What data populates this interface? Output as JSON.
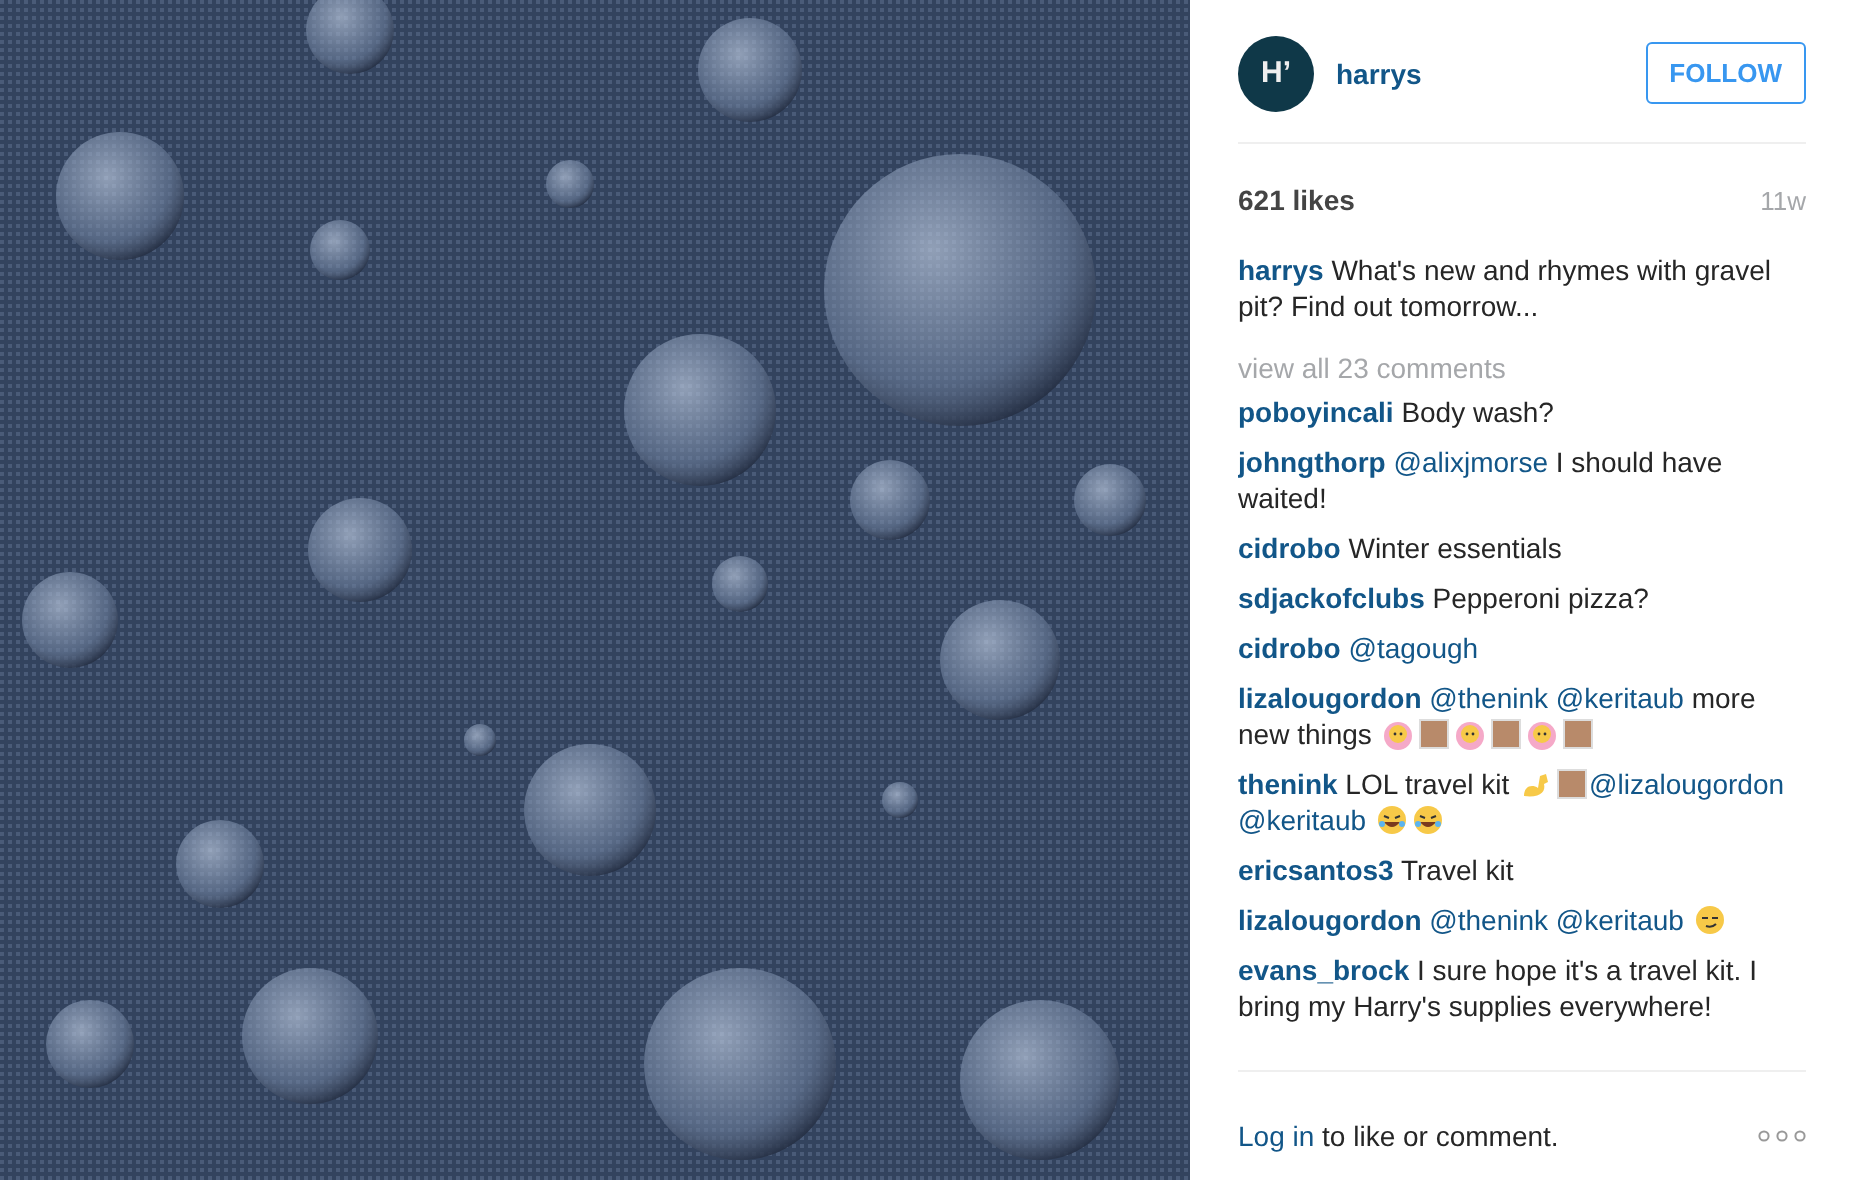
{
  "post": {
    "avatar_letter": "H’",
    "username": "harrys",
    "follow_button": "FOLLOW",
    "likes": "621 likes",
    "age": "11w",
    "caption": {
      "user": "harrys",
      "text": "What's new and rhymes with gravel pit? Find out tomorrow..."
    },
    "view_all": "view all 23 comments",
    "comments": [
      {
        "user": "poboyincali",
        "parts": [
          {
            "kind": "text",
            "text": "Body wash?"
          }
        ]
      },
      {
        "user": "johngthorp",
        "parts": [
          {
            "kind": "mention",
            "text": "@alixjmorse"
          },
          {
            "kind": "text",
            "text": "I should have waited!"
          }
        ]
      },
      {
        "user": "cidrobo",
        "parts": [
          {
            "kind": "text",
            "text": "Winter essentials"
          }
        ]
      },
      {
        "user": "sdjackofclubs",
        "parts": [
          {
            "kind": "text",
            "text": "Pepperoni pizza?"
          }
        ]
      },
      {
        "user": "cidrobo",
        "parts": [
          {
            "kind": "mention",
            "text": "@tagough"
          }
        ]
      },
      {
        "user": "lizalougordon",
        "parts": [
          {
            "kind": "mention",
            "text": "@thenink"
          },
          {
            "kind": "mention",
            "text": "@keritaub"
          },
          {
            "kind": "text",
            "text": "more new things"
          },
          {
            "kind": "face"
          },
          {
            "kind": "swatch"
          },
          {
            "kind": "face"
          },
          {
            "kind": "swatch"
          },
          {
            "kind": "face"
          },
          {
            "kind": "swatch"
          }
        ]
      },
      {
        "user": "thenink",
        "parts": [
          {
            "kind": "text",
            "text": "LOL travel kit"
          },
          {
            "kind": "arm"
          },
          {
            "kind": "swatch"
          },
          {
            "kind": "mention",
            "text": "@lizalougordon"
          },
          {
            "kind": "mention",
            "text": "@keritaub"
          },
          {
            "kind": "laughing"
          },
          {
            "kind": "laughing"
          }
        ]
      },
      {
        "user": "ericsantos3",
        "parts": [
          {
            "kind": "text",
            "text": "Travel kit"
          }
        ]
      },
      {
        "user": "lizalougordon",
        "parts": [
          {
            "kind": "mention",
            "text": "@thenink"
          },
          {
            "kind": "mention",
            "text": "@keritaub"
          },
          {
            "kind": "smirk"
          }
        ]
      },
      {
        "user": "evans_brock",
        "parts": [
          {
            "kind": "text",
            "text": "I sure hope it's a travel kit. I bring my Harry's supplies everywhere!"
          }
        ]
      }
    ],
    "login_link": "Log in",
    "login_text": "to like or comment."
  }
}
